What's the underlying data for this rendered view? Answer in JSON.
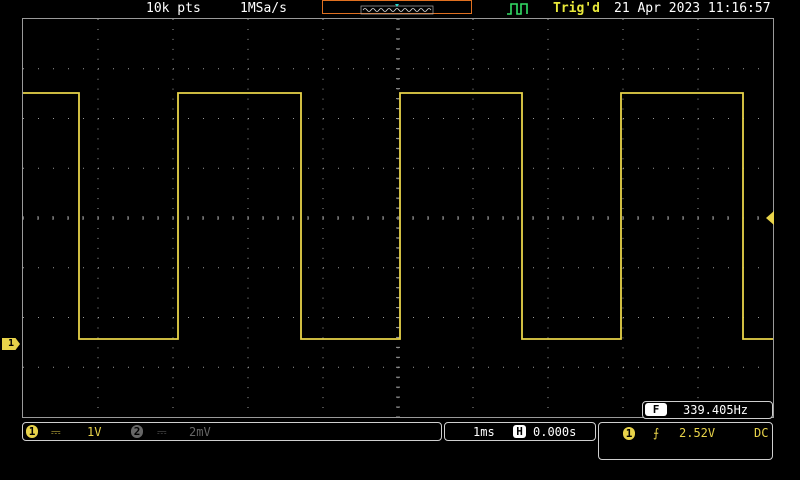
{
  "header": {
    "record_length": "10k pts",
    "sample_rate": "1MSa/s",
    "trigger_status": "Trig'd",
    "datetime": "21 Apr 2023 11:16:57"
  },
  "markers": {
    "ch1_label": "1"
  },
  "measurement": {
    "badge": "F",
    "frequency": "339.405Hz"
  },
  "channels": {
    "ch1": {
      "label": "1",
      "coupling_symbol": "⎓",
      "scale": "1V"
    },
    "ch2": {
      "label": "2",
      "coupling_symbol": "⎓",
      "scale": "2mV"
    }
  },
  "timebase": {
    "scale": "1ms",
    "position_badge": "H",
    "position": "0.000s"
  },
  "trigger": {
    "source": "1",
    "slope_symbol": "⨍",
    "level": "2.52V",
    "coupling": "DC"
  },
  "colors": {
    "ch1": "#e8d34a",
    "grid": "#9a9a9a",
    "trigger_marker": "#e85a20",
    "ch2_disabled": "#666666"
  }
}
